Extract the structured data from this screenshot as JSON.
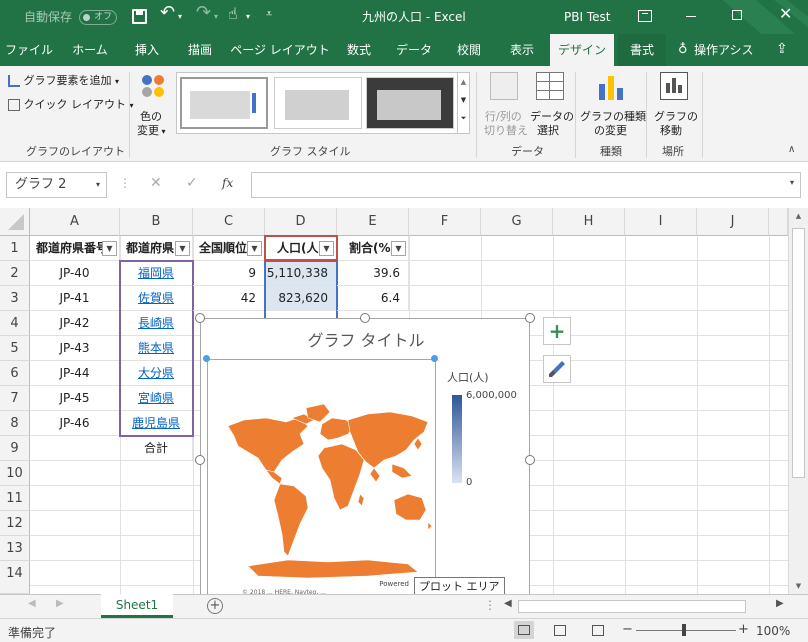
{
  "titlebar": {
    "autosave_label": "自動保存",
    "autosave_state": "オフ",
    "doc_title": "九州の人口  -  Excel",
    "account": "PBI Test",
    "icons": [
      "save-icon",
      "undo-icon",
      "redo-icon",
      "touch-mode-icon",
      "customize-icon",
      "ribbon-display-icon",
      "minimize-icon",
      "maximize-icon",
      "close-icon"
    ]
  },
  "tabs": [
    "ファイル",
    "ホーム",
    "挿入",
    "描画",
    "ページ レイアウト",
    "数式",
    "データ",
    "校閲",
    "表示",
    "デザイン",
    "書式"
  ],
  "tell_me": "操作アシス",
  "ribbon": {
    "add_element": "グラフ要素を追加",
    "quick_layout": "クイック レイアウト",
    "group_layout": "グラフのレイアウト",
    "change_color_1": "色の",
    "change_color_2": "変更",
    "group_style": "グラフ スタイル",
    "switch_rowcol_1": "行/列の",
    "switch_rowcol_2": "切り替え",
    "select_data_1": "データの",
    "select_data_2": "選択",
    "group_data": "データ",
    "change_type_1": "グラフの種類",
    "change_type_2": "の変更",
    "group_type": "種類",
    "move_chart_1": "グラフの",
    "move_chart_2": "移動",
    "group_location": "場所"
  },
  "formula_bar": {
    "name_box": "グラフ 2",
    "fx": "fx",
    "formula": ""
  },
  "columns": [
    "A",
    "B",
    "C",
    "D",
    "E",
    "F",
    "G",
    "H",
    "I",
    "J"
  ],
  "rows": [
    "1",
    "2",
    "3",
    "4",
    "5",
    "6",
    "7",
    "8",
    "9",
    "10",
    "11",
    "12",
    "13",
    "14"
  ],
  "table": {
    "headers": [
      "都道府県番号",
      "都道府県",
      "全国順位",
      "人口(人)",
      "割合(%)"
    ],
    "codes": [
      "JP-40",
      "JP-41",
      "JP-42",
      "JP-43",
      "JP-44",
      "JP-45",
      "JP-46"
    ],
    "prefectures": [
      "福岡県",
      "佐賀県",
      "長崎県",
      "熊本県",
      "大分県",
      "宮崎県",
      "鹿児島県"
    ],
    "rank": [
      "9",
      "42"
    ],
    "population": [
      "5,110,338",
      "823,620"
    ],
    "ratio": [
      "39.6",
      "6.4"
    ],
    "total_label": "合計"
  },
  "chart": {
    "title": "グラフ タイトル",
    "legend_title": "人口(人)",
    "legend_max": "6,000,000",
    "legend_min": "0",
    "powered_by": "Powered",
    "copyright": "© 2018 ... HERE, Navteq, ...",
    "map_color": "#ed7d31",
    "scale_top_color": "#2f5597",
    "scale_bottom_color": "#dae3f3"
  },
  "tooltip": "プロット エリア",
  "sheet_tab": "Sheet1",
  "status": {
    "ready": "準備完了",
    "zoom": "100%"
  },
  "colors": {
    "excel_green": "#217346",
    "ribbon_bg": "#f3f3f3"
  }
}
